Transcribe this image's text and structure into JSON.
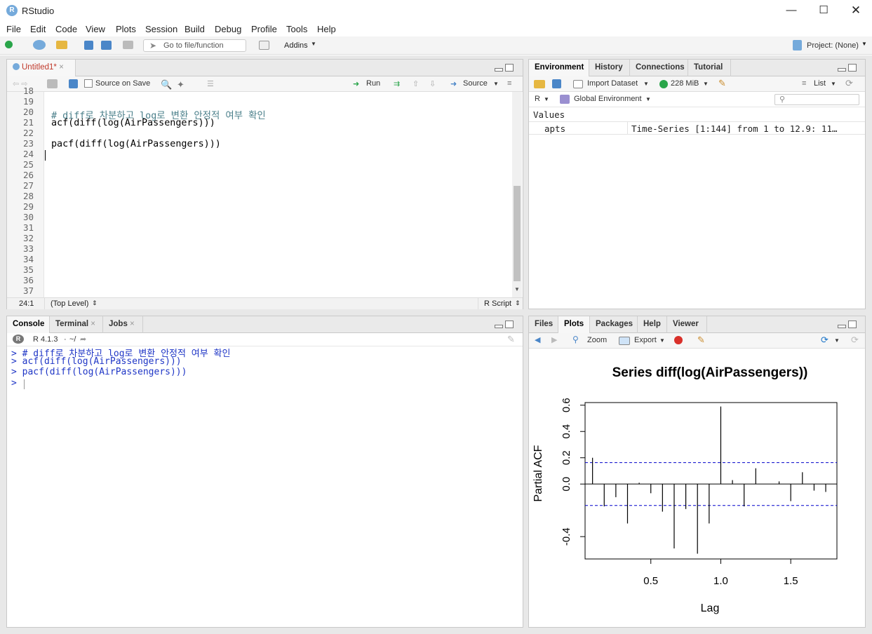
{
  "window": {
    "title": "RStudio"
  },
  "menu": [
    "File",
    "Edit",
    "Code",
    "View",
    "Plots",
    "Session",
    "Build",
    "Debug",
    "Profile",
    "Tools",
    "Help"
  ],
  "toolbar": {
    "goto_placeholder": "Go to file/function",
    "addins": "Addins",
    "project": "Project: (None)"
  },
  "editor": {
    "tab": "Untitled1*",
    "source_on_save": "Source on Save",
    "run": "Run",
    "source": "Source",
    "line_numbers": [
      "18",
      "19",
      "20",
      "21",
      "22",
      "23",
      "24",
      "25",
      "26",
      "27",
      "28",
      "29",
      "30",
      "31",
      "32",
      "33",
      "34",
      "35",
      "36",
      "37"
    ],
    "lines": {
      "20": "# diff로 차분하고 log로 변환 안정적 여부 확인",
      "21": "acf(diff(log(AirPassengers)))",
      "23": "pacf(diff(log(AirPassengers)))"
    },
    "status_pos": "24:1",
    "status_scope": "(Top Level)",
    "status_type": "R Script"
  },
  "console": {
    "tabs": [
      "Console",
      "Terminal",
      "Jobs"
    ],
    "version": "R 4.1.3",
    "path": "~/",
    "lines": [
      "> # diff로 차분하고 log로 변환 안정적 여부 확인",
      "> acf(diff(log(AirPassengers)))",
      "> pacf(diff(log(AirPassengers)))",
      "> "
    ]
  },
  "environment": {
    "tabs": [
      "Environment",
      "History",
      "Connections",
      "Tutorial"
    ],
    "import_dataset": "Import Dataset",
    "memory": "228 MiB",
    "list": "List",
    "lang": "R",
    "scope": "Global Environment",
    "section": "Values",
    "rows": [
      {
        "name": "apts",
        "value": "Time-Series [1:144] from 1 to 12.9: 11…"
      }
    ]
  },
  "files": {
    "tabs": [
      "Files",
      "Plots",
      "Packages",
      "Help",
      "Viewer"
    ],
    "zoom": "Zoom",
    "export": "Export"
  },
  "chart_data": {
    "type": "bar",
    "title": "Series  diff(log(AirPassengers))",
    "xlabel": "Lag",
    "ylabel": "Partial ACF",
    "xlim": [
      0.03,
      1.83
    ],
    "ylim": [
      -0.57,
      0.62
    ],
    "xticks": [
      0.5,
      1.0,
      1.5
    ],
    "xtick_labels": [
      "0.5",
      "1.0",
      "1.5"
    ],
    "yticks": [
      -0.4,
      0.0,
      0.2,
      0.4,
      0.6
    ],
    "ytick_labels": [
      "-0.4",
      "0.0",
      "0.2",
      "0.4",
      "0.6"
    ],
    "ci": 0.163,
    "ci_color": "#0000cc",
    "x": [
      0.0833,
      0.1667,
      0.25,
      0.3333,
      0.4167,
      0.5,
      0.5833,
      0.6667,
      0.75,
      0.8333,
      0.9167,
      1.0,
      1.0833,
      1.1667,
      1.25,
      1.3333,
      1.4167,
      1.5,
      1.5833,
      1.6667,
      1.75
    ],
    "values": [
      0.2,
      -0.17,
      -0.1,
      -0.3,
      0.01,
      -0.07,
      -0.21,
      -0.49,
      -0.19,
      -0.53,
      -0.3,
      0.59,
      0.03,
      -0.17,
      0.12,
      0.0,
      0.02,
      -0.13,
      0.09,
      -0.05,
      -0.06
    ]
  }
}
